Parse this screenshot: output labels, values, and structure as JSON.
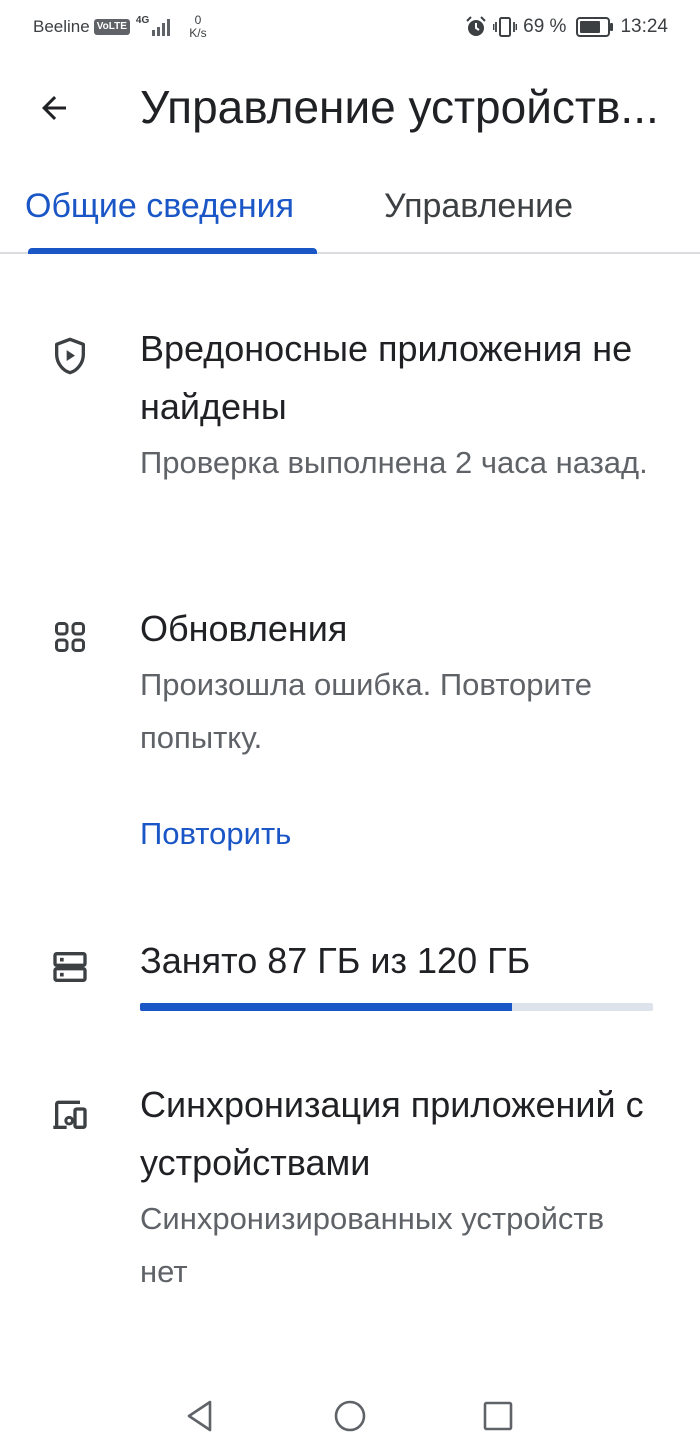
{
  "status_bar": {
    "carrier": "Beeline",
    "volte": "VoLTE",
    "network": "4G",
    "network_sub": "+",
    "speed_value": "0",
    "speed_unit": "K/s",
    "battery": "69 %",
    "time": "13:24"
  },
  "app_bar": {
    "title": "Управление устройств..."
  },
  "tabs": [
    {
      "label": "Общие сведения",
      "selected": true
    },
    {
      "label": "Управление",
      "selected": false
    }
  ],
  "sections": {
    "malware": {
      "icon": "shield-play-icon",
      "title": "Вредоносные приложения не найдены",
      "subtitle": "Проверка выполнена 2 часа назад."
    },
    "updates": {
      "icon": "apps-grid-icon",
      "title": "Обновления",
      "subtitle": "Произошла ошибка. Повторите попытку.",
      "action": "Повторить"
    },
    "storage": {
      "icon": "storage-icon",
      "title": "Занято 87 ГБ из 120 ГБ",
      "used_fraction": 0.725
    },
    "sync": {
      "icon": "devices-icon",
      "title": "Синхронизация приложений с устройствами",
      "subtitle": "Синхронизированных устройств нет"
    }
  },
  "colors": {
    "accent": "#1a56c6",
    "text_primary": "#202124",
    "text_secondary": "#5f6368",
    "track": "#dde3ea"
  }
}
